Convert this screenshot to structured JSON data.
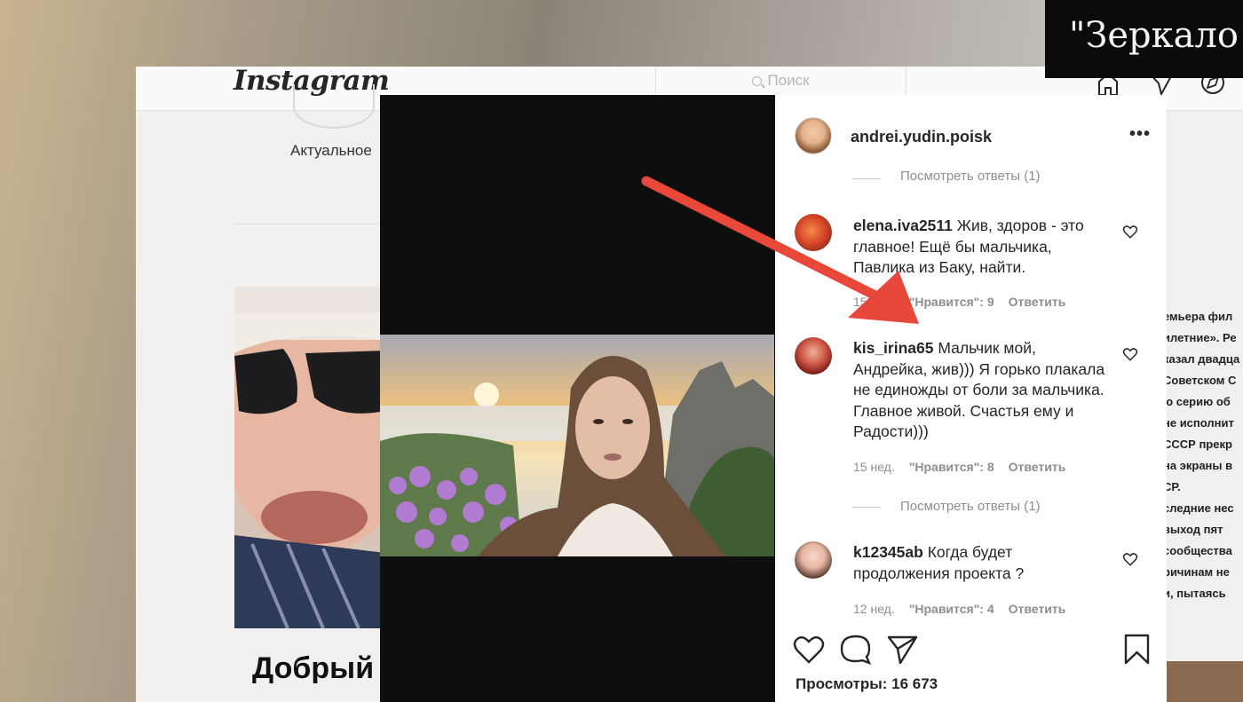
{
  "background_page": {
    "logo": "Instagram",
    "search_placeholder": "Поиск",
    "highlight_label": "Актуальное",
    "caption": "Добрый Андрей",
    "side_text": [
      "емьера фил",
      "илетние». Ре",
      "казал двадца",
      "Советском С",
      "ю серию об",
      "не исполнит",
      "СССР прекр",
      "на экраны в",
      "СР.",
      "следние нес",
      "выход пят",
      "сообщества",
      "ричинам не",
      "и, пытаясь"
    ]
  },
  "post": {
    "username": "andrei.yudin.poisk",
    "more_icon": "more-horizontal-icon",
    "view_replies_top": "Посмотреть ответы (1)",
    "comments": [
      {
        "username": "elena.iva2511",
        "text": "Жив, здоров - это главное! Ещё бы мальчика, Павлика из Баку, найти.",
        "time": "15 нед.",
        "likes": "\"Нравится\": 9",
        "reply": "Ответить"
      },
      {
        "username": "kis_irina65",
        "text": "Мальчик мой, Андрейка, жив))) Я горько плакала не единожды от боли за мальчика. Главное живой. Счастья ему и Радости)))",
        "time": "15 нед.",
        "likes": "\"Нравится\": 8",
        "reply": "Ответить",
        "view_replies": "Посмотреть ответы (1)"
      },
      {
        "username": "k12345ab",
        "text": "Когда будет продолжения проекта ?",
        "time": "12 нед.",
        "likes": "\"Нравится\": 4",
        "reply": "Ответить"
      }
    ],
    "views": "Просмотры: 16 673"
  },
  "overlay_title": "\"Зеркало э",
  "colors": {
    "arrow": "#e8473c",
    "modal_backdrop": "#0e0e0e",
    "text_primary": "#262626",
    "text_secondary": "#8e8e8e"
  }
}
